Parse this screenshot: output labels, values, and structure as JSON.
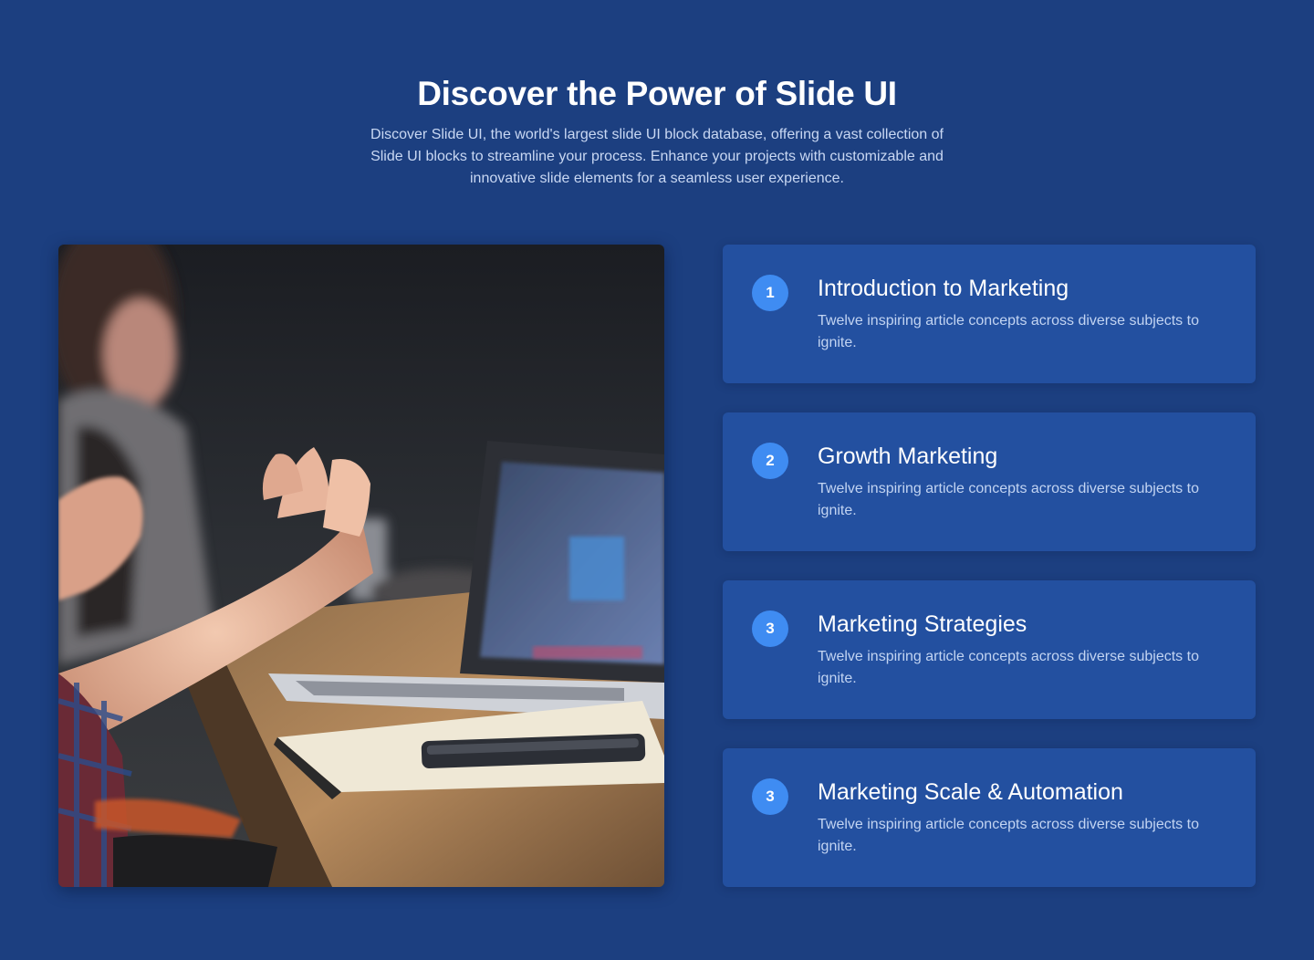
{
  "header": {
    "title": "Discover the Power of Slide UI",
    "description": "Discover Slide UI, the world's largest slide UI block database, offering a vast collection of Slide UI blocks to streamline your process. Enhance your projects with customizable and innovative slide elements for a seamless user experience."
  },
  "image": {
    "subject": "meeting-photo"
  },
  "features": [
    {
      "number": "1",
      "title": "Introduction to Marketing",
      "description": "Twelve inspiring article concepts across diverse subjects to ignite."
    },
    {
      "number": "2",
      "title": "Growth Marketing",
      "description": "Twelve inspiring article concepts across diverse subjects to ignite."
    },
    {
      "number": "3",
      "title": "Marketing Strategies",
      "description": "Twelve inspiring article concepts across diverse subjects to ignite."
    },
    {
      "number": "3",
      "title": "Marketing Scale & Automation",
      "description": "Twelve inspiring article concepts across diverse subjects to ignite."
    }
  ],
  "colors": {
    "background": "#1c3f80",
    "card": "#2350a0",
    "badge": "#3f8cf2"
  }
}
